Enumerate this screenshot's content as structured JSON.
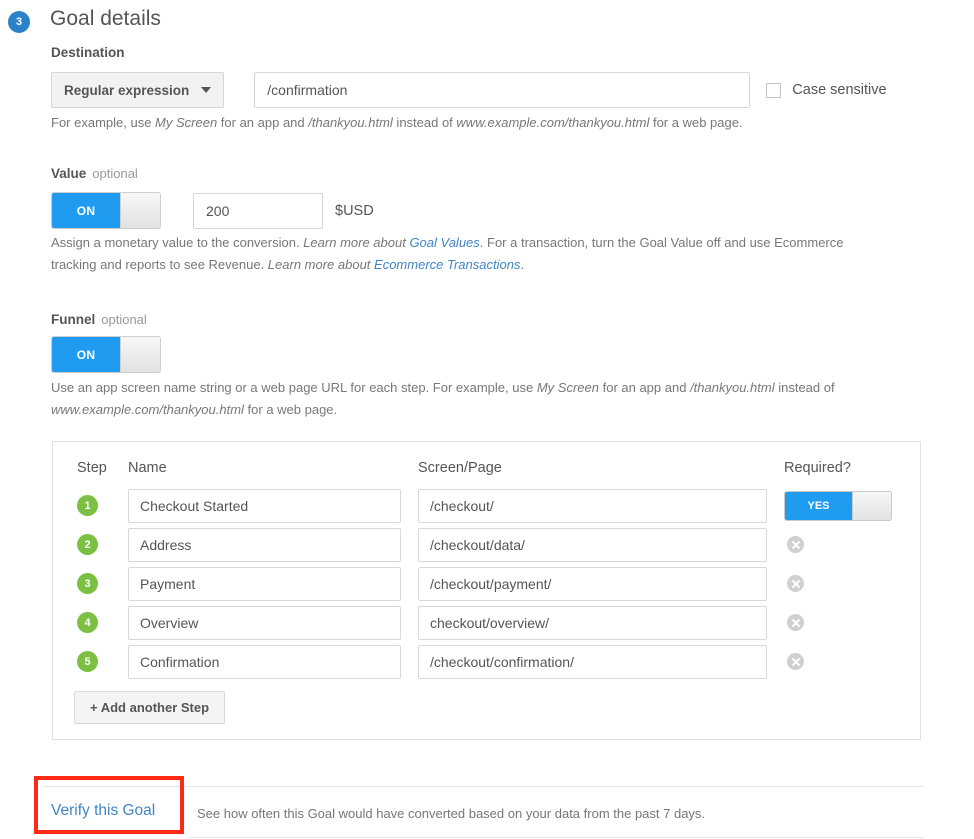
{
  "section": {
    "step_number": "3",
    "title": "Goal details"
  },
  "destination": {
    "label": "Destination",
    "match_type": "Regular expression",
    "value": "/confirmation",
    "placeholder": "",
    "case_sensitive_label": "Case sensitive",
    "case_sensitive_checked": false,
    "help": {
      "part1": "For example, use ",
      "em1": "My Screen",
      "part2": " for an app and ",
      "em2": "/thankyou.html",
      "part3": " instead of ",
      "em3": "www.example.com/thankyou.html",
      "part4": " for a web page."
    }
  },
  "value": {
    "label": "Value",
    "optional": "optional",
    "toggle_state": "ON",
    "amount": "200",
    "currency": "$USD",
    "help": {
      "part1": "Assign a monetary value to the conversion. ",
      "link1_pre": "Learn more about ",
      "link1": "Goal Values",
      "part2": ". For a transaction, turn the Goal Value off and use Ecommerce tracking and reports to see Revenue. ",
      "link2_pre": "Learn more about ",
      "link2": "Ecommerce Transactions",
      "part3": "."
    }
  },
  "funnel": {
    "label": "Funnel",
    "optional": "optional",
    "toggle_state": "ON",
    "help": {
      "part1": "Use an app screen name string or a web page URL for each step. For example, use ",
      "em1": "My Screen",
      "part2": " for an app and ",
      "em2": "/thankyou.html",
      "part3": " instead of ",
      "em3": "www.example.com/thankyou.html",
      "part4": " for a web page."
    },
    "columns": {
      "step": "Step",
      "name": "Name",
      "screen": "Screen/Page",
      "required": "Required?"
    },
    "steps": [
      {
        "number": "1",
        "name": "Checkout Started",
        "screen": "/checkout/",
        "required_toggle": "YES",
        "has_toggle": true
      },
      {
        "number": "2",
        "name": "Address",
        "screen": "/checkout/data/",
        "has_toggle": false
      },
      {
        "number": "3",
        "name": "Payment",
        "screen": "/checkout/payment/",
        "has_toggle": false
      },
      {
        "number": "4",
        "name": "Overview",
        "screen": "checkout/overview/",
        "has_toggle": false
      },
      {
        "number": "5",
        "name": "Confirmation",
        "screen": "/checkout/confirmation/",
        "has_toggle": false
      }
    ],
    "add_step_label": "+ Add another Step"
  },
  "footer": {
    "verify_link": "Verify this Goal",
    "verify_description": "See how often this Goal would have converted based on your data from the past 7 days."
  },
  "colors": {
    "blue_badge": "#2c82c9",
    "green_badge": "#7cc043",
    "toggle_on": "#1f9cf0",
    "link": "#4285c4",
    "highlight": "#ff2a16"
  }
}
